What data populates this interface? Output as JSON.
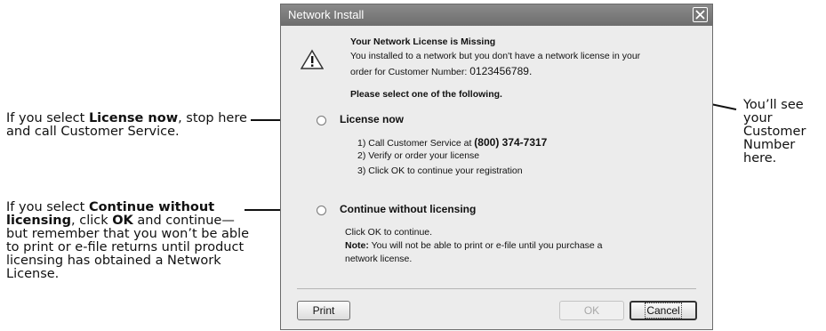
{
  "dialog": {
    "title": "Network Install",
    "heading": "Your Network License is Missing",
    "message_line1": "You installed to a network but you don't have a network license in your",
    "message_line2_prefix": "order for Customer Number: ",
    "customer_number": "0123456789.",
    "instruction": "Please select one of the following.",
    "option_license": {
      "label": "License now",
      "step1_prefix": "1) Call Customer Service at ",
      "phone": "(800) 374-7317",
      "step2": "2) Verify or order your license",
      "step3": "3) Click OK to continue your registration"
    },
    "option_continue": {
      "label": "Continue without licensing",
      "line1": "Click OK to continue.",
      "note_label": "Note:",
      "note_text": "  You will not be able to print or e-file until you purchase a",
      "note_text2": "network license."
    },
    "buttons": {
      "print": "Print",
      "ok": "OK",
      "cancel": "Cancel"
    }
  },
  "callouts": {
    "left1": {
      "pre": "If you select ",
      "bold": "License now",
      "post": ", stop here and call Customer Service."
    },
    "left2": {
      "pre": "If you select ",
      "bold1": "Continue without licensing",
      "mid": ", click ",
      "bold2": "OK",
      "post": " and continue—but remember that you won’t be able to print or e-file returns until product licensing has obtained a Network License."
    },
    "right": "You’ll see your Customer Number here."
  }
}
